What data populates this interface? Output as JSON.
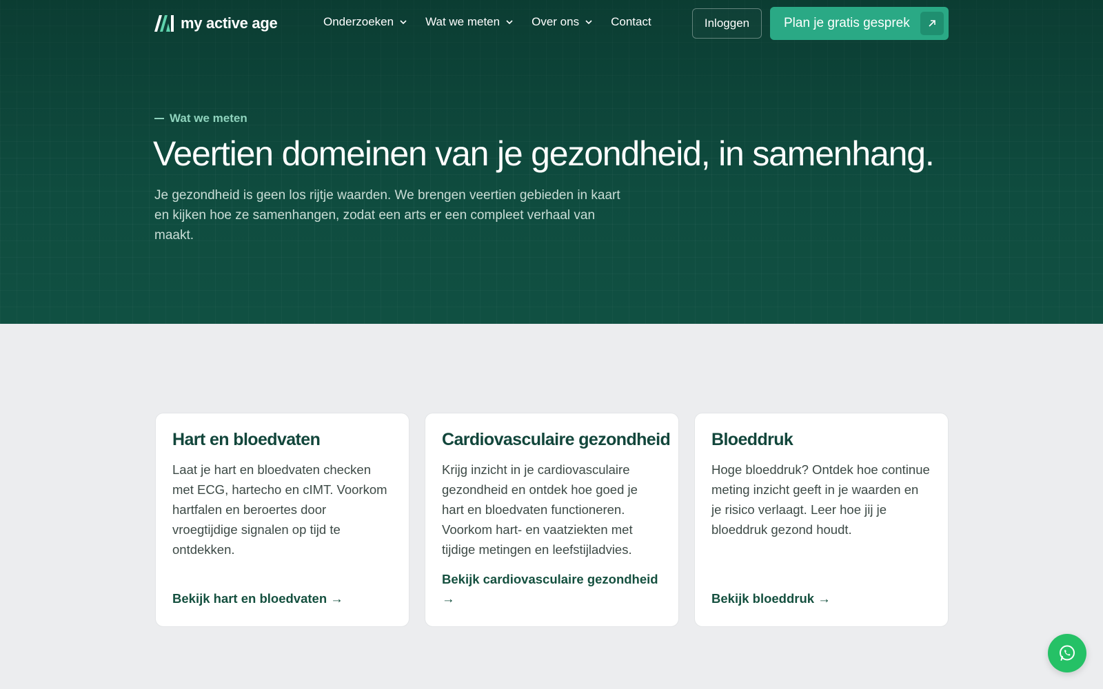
{
  "brand": {
    "name": "my active age",
    "logo_icon": "brand-logo-icon"
  },
  "nav": {
    "items": [
      {
        "label": "Onderzoeken",
        "has_dropdown": true
      },
      {
        "label": "Wat we meten",
        "has_dropdown": true
      },
      {
        "label": "Over ons",
        "has_dropdown": true
      },
      {
        "label": "Contact",
        "has_dropdown": false
      }
    ],
    "login_label": "Inloggen",
    "cta_label": "Plan je gratis gesprek",
    "cta_icon": "arrow-up-right-icon"
  },
  "hero": {
    "eyebrow": "Wat we meten",
    "title": "Veertien domeinen van je gezondheid, in samenhang.",
    "subtitle": "Je gezondheid is geen los rijtje waarden. We brengen veertien gebieden in kaart en kijken hoe ze samenhangen, zodat een arts er een compleet verhaal van maakt."
  },
  "cards": [
    {
      "title": "Hart en bloedvaten",
      "body": "Laat je hart en bloedvaten checken met ECG, hartecho en cIMT. Voorkom hartfalen en beroertes door vroegtijdige signalen op tijd te ontdekken.",
      "link": "Bekijk hart en bloedvaten →"
    },
    {
      "title": "Cardiovasculaire gezondheid",
      "body": "Krijg inzicht in je cardiovasculaire gezondheid en ontdek hoe goed je hart en bloedvaten functioneren. Voorkom hart- en vaatziekten met tijdige metingen en leefstijladvies.",
      "link": "Bekijk cardiovasculaire gezondheid →"
    },
    {
      "title": "Bloeddruk",
      "body": "Hoge bloeddruk? Ontdek hoe continue meting inzicht geeft in je waarden en je risico verlaagt. Leer hoe jij je bloeddruk gezond houdt.",
      "link": "Bekijk bloeddruk →"
    }
  ],
  "floating": {
    "whatsapp_icon": "whatsapp-icon"
  },
  "colors": {
    "hero_bg": "#0f4c3f",
    "accent": "#2aa985",
    "page_bg": "#ecedef",
    "heading": "#12463b",
    "whatsapp": "#25c166"
  }
}
